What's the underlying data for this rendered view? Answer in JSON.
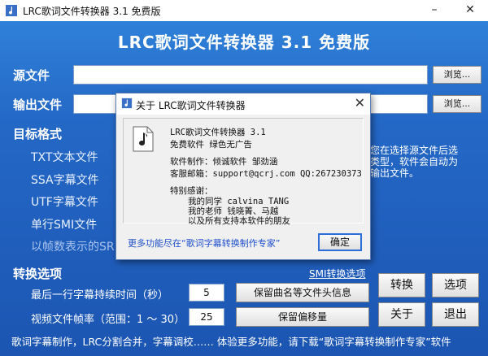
{
  "window": {
    "title": "LRC歌词文件转换器 3.1 免费版",
    "minimize": "–",
    "close": "✕"
  },
  "headline": "LRC歌词文件转换器 3.1 免费版",
  "source": {
    "label": "源文件",
    "value": "",
    "browse": "浏览..."
  },
  "output": {
    "label": "输出文件",
    "value": "",
    "browse": "浏览..."
  },
  "target_format": {
    "label": "目标格式",
    "items": [
      "TXT文本文件",
      "SSA字幕文件",
      "UTF字幕文件",
      "单行SMI文件",
      "以帧数表示的SR"
    ]
  },
  "side_hint": "您在选择源文件后选\n类型，软件会自动为\n输出文件。",
  "smi_link": "SMI转换选项",
  "options": {
    "label": "转换选项",
    "rows": [
      {
        "label": "最后一行字幕持续时间（秒）",
        "value": "5",
        "button": "保留曲名等文件头信息"
      },
      {
        "label": "视频文件帧率（范围：1 ～ 30）",
        "value": "25",
        "button": "保留偏移量"
      }
    ]
  },
  "buttons": {
    "convert": "转换",
    "options": "选项",
    "about": "关于",
    "exit": "退出"
  },
  "footer": "歌词字幕制作，LRC分割合并，字幕调校……  体验更多功能，请下载“歌词字幕转换制作专家”软件",
  "dialog": {
    "title": "关于 LRC歌词文件转换器",
    "close": "✕",
    "lines": [
      "LRC歌词文件转换器 3.1",
      "免费软件  绿色无广告",
      "软件制作：倾诚软件  邹劲涵",
      "客服邮箱：support@qcrj.com  QQ:267230373",
      "特别感谢：",
      "我的同学 calvina TANG",
      "我的老师 钱晓菁、马越",
      "以及所有支持本软件的朋友"
    ],
    "more": "更多功能尽在“歌词字幕转换制作专家”",
    "ok": "确定"
  },
  "colors": {
    "background": "#2468c6",
    "link": "#1f4fcc",
    "ok_border": "#2d6dd8"
  }
}
